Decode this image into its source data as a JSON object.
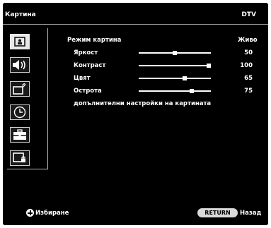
{
  "header": {
    "title": "Картина",
    "source": "DTV"
  },
  "sidebar": {
    "items": [
      {
        "name": "picture-menu",
        "selected": true
      },
      {
        "name": "sound-menu",
        "selected": false
      },
      {
        "name": "channel-menu",
        "selected": false
      },
      {
        "name": "timer-menu",
        "selected": false
      },
      {
        "name": "setup-menu",
        "selected": false
      },
      {
        "name": "lock-menu",
        "selected": false
      }
    ]
  },
  "picture_menu": {
    "mode_label": "Режим картина",
    "mode_value": "Живо",
    "settings": [
      {
        "label": "Яркост",
        "value": "50",
        "level": 0.5
      },
      {
        "label": "Контраст",
        "value": "100",
        "level": 1.0
      },
      {
        "label": "Цвят",
        "value": "65",
        "level": 0.65
      },
      {
        "label": "Острота",
        "value": "75",
        "level": 0.75
      }
    ],
    "advanced_label": "допълнителни настройки на картината"
  },
  "footer": {
    "select_label": "Избиране",
    "return_key": "RETURN",
    "back_label": "Назад"
  }
}
